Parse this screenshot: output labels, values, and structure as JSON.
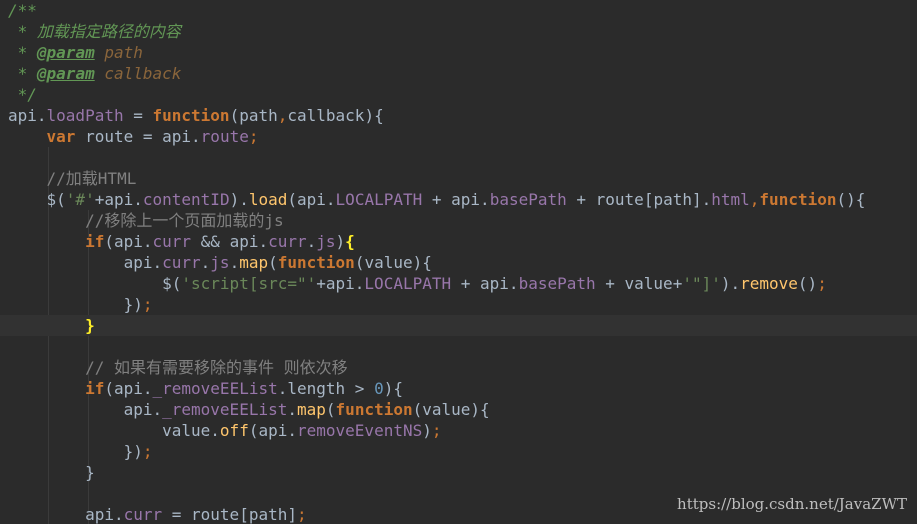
{
  "colors": {
    "background": "#2b2b2b",
    "current_line": "#323232",
    "plain": "#a9b7c6",
    "keyword": "#cc7832",
    "property": "#9876aa",
    "function_name": "#ffc66d",
    "string": "#6a8759",
    "number": "#6897bb",
    "line_comment": "#808080",
    "doc_comment": "#629755",
    "doc_param": "#8a653b",
    "bracket_match": "#ffef28"
  },
  "editor": {
    "current_line_index": 15,
    "lines": [
      [
        {
          "t": "/**",
          "c": "doc"
        }
      ],
      [
        {
          "t": " * 加载指定路径的内容",
          "c": "doc"
        }
      ],
      [
        {
          "t": " * ",
          "c": "doc"
        },
        {
          "t": "@param",
          "c": "tag"
        },
        {
          "t": " path",
          "c": "param"
        }
      ],
      [
        {
          "t": " * ",
          "c": "doc"
        },
        {
          "t": "@param",
          "c": "tag"
        },
        {
          "t": " callback",
          "c": "param"
        }
      ],
      [
        {
          "t": " */",
          "c": "doc"
        }
      ],
      [
        {
          "t": "api.",
          "c": "pl"
        },
        {
          "t": "loadPath",
          "c": "prop"
        },
        {
          "t": " = ",
          "c": "pl"
        },
        {
          "t": "function",
          "c": "kw"
        },
        {
          "t": "(path",
          "c": "pl"
        },
        {
          "t": ",",
          "c": "semi"
        },
        {
          "t": "callback){",
          "c": "pl"
        }
      ],
      [
        {
          "t": "    ",
          "c": "pl"
        },
        {
          "t": "var",
          "c": "kw"
        },
        {
          "t": " route = api.",
          "c": "pl"
        },
        {
          "t": "route",
          "c": "prop"
        },
        {
          "t": ";",
          "c": "semi"
        }
      ],
      [],
      [
        {
          "t": "    //加载HTML",
          "c": "cm"
        }
      ],
      [
        {
          "t": "    $(",
          "c": "pl"
        },
        {
          "t": "'#'",
          "c": "str"
        },
        {
          "t": "+api.",
          "c": "pl"
        },
        {
          "t": "contentID",
          "c": "prop"
        },
        {
          "t": ").",
          "c": "pl"
        },
        {
          "t": "load",
          "c": "fn"
        },
        {
          "t": "(api.",
          "c": "pl"
        },
        {
          "t": "LOCALPATH",
          "c": "prop"
        },
        {
          "t": " + api.",
          "c": "pl"
        },
        {
          "t": "basePath",
          "c": "prop"
        },
        {
          "t": " + route[path].",
          "c": "pl"
        },
        {
          "t": "html",
          "c": "prop"
        },
        {
          "t": ",",
          "c": "semi"
        },
        {
          "t": "function",
          "c": "kw"
        },
        {
          "t": "(){",
          "c": "pl"
        }
      ],
      [
        {
          "t": "        //移除上一个页面加载的js",
          "c": "cm"
        }
      ],
      [
        {
          "t": "        ",
          "c": "pl"
        },
        {
          "t": "if",
          "c": "kw"
        },
        {
          "t": "(api.",
          "c": "pl"
        },
        {
          "t": "curr",
          "c": "prop"
        },
        {
          "t": " && api.",
          "c": "pl"
        },
        {
          "t": "curr",
          "c": "prop"
        },
        {
          "t": ".",
          "c": "pl"
        },
        {
          "t": "js",
          "c": "prop"
        },
        {
          "t": ")",
          "c": "pl"
        },
        {
          "t": "{",
          "c": "match"
        }
      ],
      [
        {
          "t": "            api.",
          "c": "pl"
        },
        {
          "t": "curr",
          "c": "prop"
        },
        {
          "t": ".",
          "c": "pl"
        },
        {
          "t": "js",
          "c": "prop"
        },
        {
          "t": ".",
          "c": "pl"
        },
        {
          "t": "map",
          "c": "fn"
        },
        {
          "t": "(",
          "c": "pl"
        },
        {
          "t": "function",
          "c": "kw"
        },
        {
          "t": "(value){",
          "c": "pl"
        }
      ],
      [
        {
          "t": "                $(",
          "c": "pl"
        },
        {
          "t": "'script[src=\"'",
          "c": "str"
        },
        {
          "t": "+api.",
          "c": "pl"
        },
        {
          "t": "LOCALPATH",
          "c": "prop"
        },
        {
          "t": " + api.",
          "c": "pl"
        },
        {
          "t": "basePath",
          "c": "prop"
        },
        {
          "t": " + value+",
          "c": "pl"
        },
        {
          "t": "'\"]'",
          "c": "str"
        },
        {
          "t": ").",
          "c": "pl"
        },
        {
          "t": "remove",
          "c": "fn"
        },
        {
          "t": "()",
          "c": "pl"
        },
        {
          "t": ";",
          "c": "semi"
        }
      ],
      [
        {
          "t": "            })",
          "c": "pl"
        },
        {
          "t": ";",
          "c": "semi"
        }
      ],
      [
        {
          "t": "        ",
          "c": "pl"
        },
        {
          "t": "}",
          "c": "match"
        }
      ],
      [],
      [
        {
          "t": "        // 如果有需要移除的事件 则依次移",
          "c": "cm"
        }
      ],
      [
        {
          "t": "        ",
          "c": "pl"
        },
        {
          "t": "if",
          "c": "kw"
        },
        {
          "t": "(api.",
          "c": "pl"
        },
        {
          "t": "_removeEEList",
          "c": "prop"
        },
        {
          "t": ".length > ",
          "c": "pl"
        },
        {
          "t": "0",
          "c": "num"
        },
        {
          "t": "){",
          "c": "pl"
        }
      ],
      [
        {
          "t": "            api.",
          "c": "pl"
        },
        {
          "t": "_removeEEList",
          "c": "prop"
        },
        {
          "t": ".",
          "c": "pl"
        },
        {
          "t": "map",
          "c": "fn"
        },
        {
          "t": "(",
          "c": "pl"
        },
        {
          "t": "function",
          "c": "kw"
        },
        {
          "t": "(value){",
          "c": "pl"
        }
      ],
      [
        {
          "t": "                value.",
          "c": "pl"
        },
        {
          "t": "off",
          "c": "fn"
        },
        {
          "t": "(api.",
          "c": "pl"
        },
        {
          "t": "removeEventNS",
          "c": "prop"
        },
        {
          "t": ")",
          "c": "pl"
        },
        {
          "t": ";",
          "c": "semi"
        }
      ],
      [
        {
          "t": "            })",
          "c": "pl"
        },
        {
          "t": ";",
          "c": "semi"
        }
      ],
      [
        {
          "t": "        }",
          "c": "pl"
        }
      ],
      [],
      [
        {
          "t": "        api.",
          "c": "pl"
        },
        {
          "t": "curr",
          "c": "prop"
        },
        {
          "t": " = route[path]",
          "c": "pl"
        },
        {
          "t": ";",
          "c": "semi"
        }
      ]
    ]
  },
  "watermark": "https://blog.csdn.net/JavaZWT"
}
